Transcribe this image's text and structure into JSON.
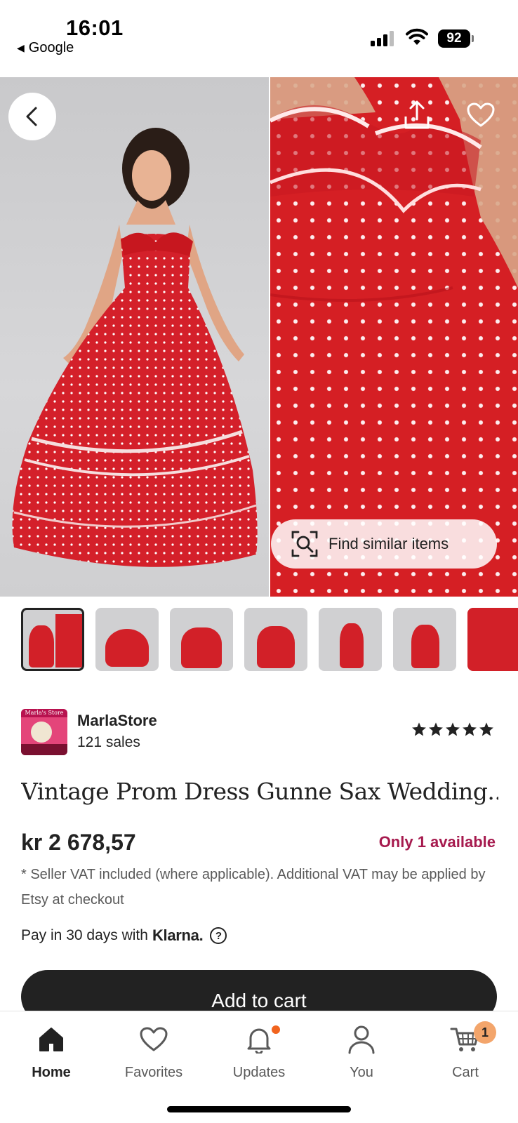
{
  "status_bar": {
    "time": "16:01",
    "back_app": "Google",
    "battery": "92"
  },
  "hero": {
    "back_icon": "chevron-left-icon",
    "share_icon": "share-icon",
    "favorite_icon": "heart-outline-icon",
    "find_similar_label": "Find similar items",
    "find_similar_icon": "visual-search-icon"
  },
  "thumbnails": {
    "count": 7,
    "active_index": 0
  },
  "shop": {
    "logo_text": "Marla's Store",
    "name": "MarlaStore",
    "sales": "121 sales",
    "rating_stars": 5
  },
  "listing": {
    "title": "Vintage Prom Dress Gunne Sax Wedding...",
    "price": "kr 2 678,57",
    "availability": "Only 1 available",
    "vat_note": "* Seller VAT included (where applicable). Additional VAT may be applied by Etsy at checkout",
    "klarna_text": "Pay in 30 days with",
    "klarna_brand": "Klarna.",
    "add_to_cart": "Add to cart"
  },
  "bottom_nav": {
    "items": [
      {
        "label": "Home",
        "icon": "home-icon",
        "active": true
      },
      {
        "label": "Favorites",
        "icon": "heart-icon"
      },
      {
        "label": "Updates",
        "icon": "bell-icon",
        "badge_dot": true
      },
      {
        "label": "You",
        "icon": "person-icon"
      },
      {
        "label": "Cart",
        "icon": "cart-icon",
        "badge": "1"
      }
    ]
  },
  "colors": {
    "accent_text": "#a61a4e",
    "badge_orange": "#f1641e",
    "dress_red": "#d51f24",
    "button_dark": "#222222"
  }
}
